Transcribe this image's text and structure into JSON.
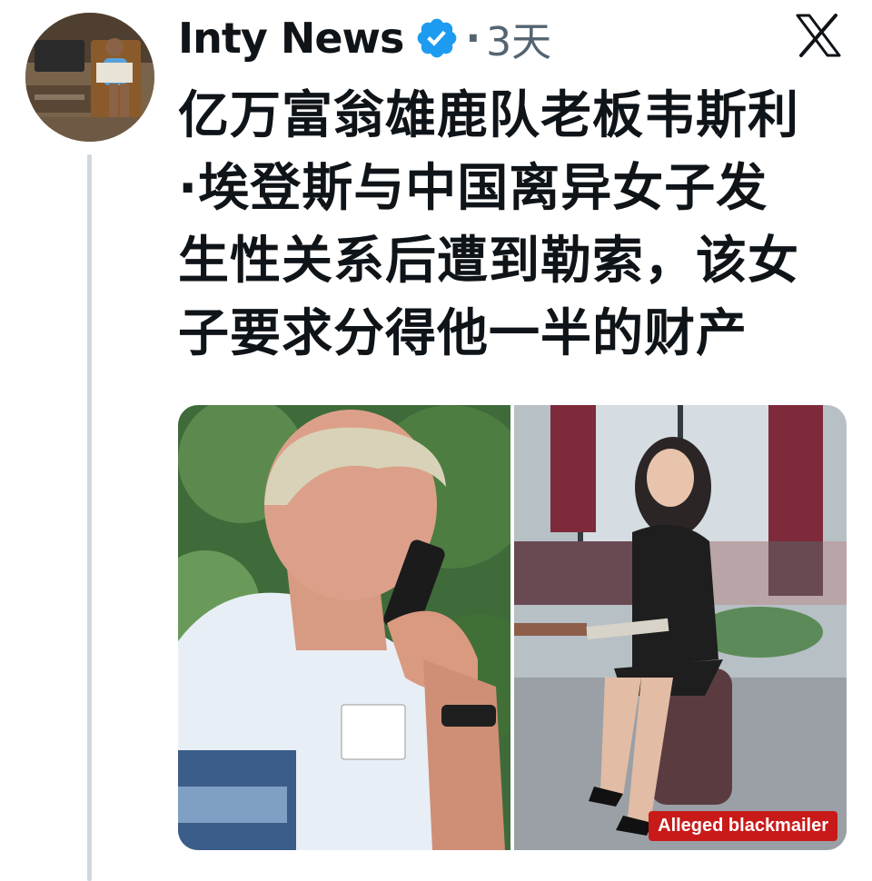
{
  "post": {
    "author": {
      "name": "Inty News",
      "verified": true,
      "avatar_icon": "avatar-photo"
    },
    "separator": "·",
    "time": "3天",
    "platform_icon": "x-logo-icon",
    "text": "亿万富翁雄鹿队老板韦斯利\n·埃登斯与中国离异女子发\n生性关系后遭到勒索，该女\n子要求分得他一半的财产",
    "media": {
      "images": [
        {
          "icon": "photo-man-on-phone"
        },
        {
          "icon": "photo-woman-seated"
        }
      ],
      "badge": "Alleged blackmailer"
    }
  },
  "colors": {
    "text": "#0f1419",
    "secondary_text": "#536471",
    "verified": "#1d9bf0",
    "thread_line": "#cfd9de",
    "badge_bg": "#c91a1a"
  }
}
